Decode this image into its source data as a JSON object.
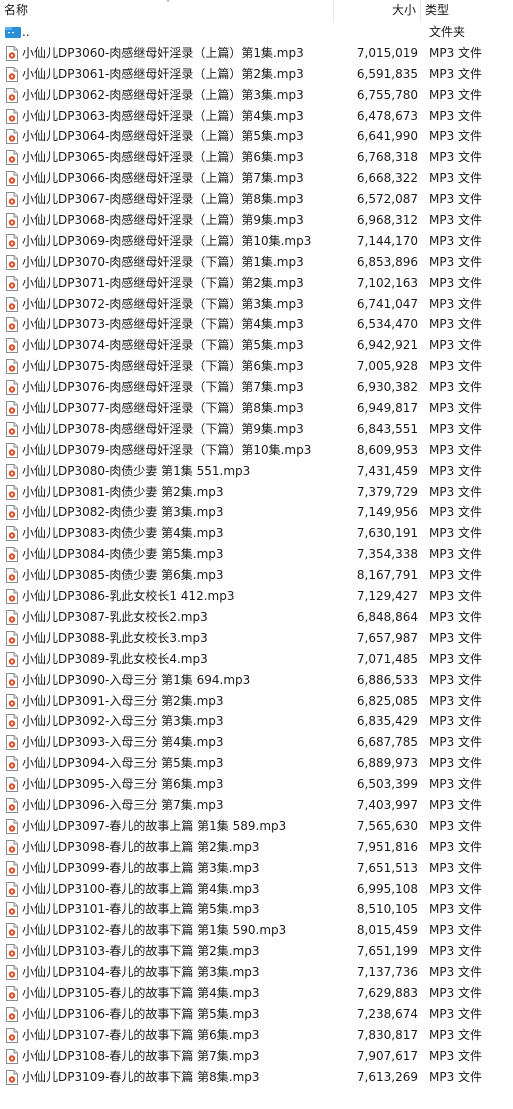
{
  "columns": {
    "name": "名称",
    "size": "大小",
    "type": "类型"
  },
  "parent": {
    "name": "..",
    "type": "文件夹"
  },
  "files": [
    {
      "name": "小仙儿DP3060-肉感继母奸淫录（上篇）第1集.mp3",
      "size": "7,015,019",
      "type": "MP3 文件"
    },
    {
      "name": "小仙儿DP3061-肉感继母奸淫录（上篇）第2集.mp3",
      "size": "6,591,835",
      "type": "MP3 文件"
    },
    {
      "name": "小仙儿DP3062-肉感继母奸淫录（上篇）第3集.mp3",
      "size": "6,755,780",
      "type": "MP3 文件"
    },
    {
      "name": "小仙儿DP3063-肉感继母奸淫录（上篇）第4集.mp3",
      "size": "6,478,673",
      "type": "MP3 文件"
    },
    {
      "name": "小仙儿DP3064-肉感继母奸淫录（上篇）第5集.mp3",
      "size": "6,641,990",
      "type": "MP3 文件"
    },
    {
      "name": "小仙儿DP3065-肉感继母奸淫录（上篇）第6集.mp3",
      "size": "6,768,318",
      "type": "MP3 文件"
    },
    {
      "name": "小仙儿DP3066-肉感继母奸淫录（上篇）第7集.mp3",
      "size": "6,668,322",
      "type": "MP3 文件"
    },
    {
      "name": "小仙儿DP3067-肉感继母奸淫录（上篇）第8集.mp3",
      "size": "6,572,087",
      "type": "MP3 文件"
    },
    {
      "name": "小仙儿DP3068-肉感继母奸淫录（上篇）第9集.mp3",
      "size": "6,968,312",
      "type": "MP3 文件"
    },
    {
      "name": "小仙儿DP3069-肉感继母奸淫录（上篇）第10集.mp3",
      "size": "7,144,170",
      "type": "MP3 文件"
    },
    {
      "name": "小仙儿DP3070-肉感继母奸淫录（下篇）第1集.mp3",
      "size": "6,853,896",
      "type": "MP3 文件"
    },
    {
      "name": "小仙儿DP3071-肉感继母奸淫录（下篇）第2集.mp3",
      "size": "7,102,163",
      "type": "MP3 文件"
    },
    {
      "name": "小仙儿DP3072-肉感继母奸淫录（下篇）第3集.mp3",
      "size": "6,741,047",
      "type": "MP3 文件"
    },
    {
      "name": "小仙儿DP3073-肉感继母奸淫录（下篇）第4集.mp3",
      "size": "6,534,470",
      "type": "MP3 文件"
    },
    {
      "name": "小仙儿DP3074-肉感继母奸淫录（下篇）第5集.mp3",
      "size": "6,942,921",
      "type": "MP3 文件"
    },
    {
      "name": "小仙儿DP3075-肉感继母奸淫录（下篇）第6集.mp3",
      "size": "7,005,928",
      "type": "MP3 文件"
    },
    {
      "name": "小仙儿DP3076-肉感继母奸淫录（下篇）第7集.mp3",
      "size": "6,930,382",
      "type": "MP3 文件"
    },
    {
      "name": "小仙儿DP3077-肉感继母奸淫录（下篇）第8集.mp3",
      "size": "6,949,817",
      "type": "MP3 文件"
    },
    {
      "name": "小仙儿DP3078-肉感继母奸淫录（下篇）第9集.mp3",
      "size": "6,843,551",
      "type": "MP3 文件"
    },
    {
      "name": "小仙儿DP3079-肉感继母奸淫录（下篇）第10集.mp3",
      "size": "8,609,953",
      "type": "MP3 文件"
    },
    {
      "name": "小仙儿DP3080-肉债少妻 第1集 551.mp3",
      "size": "7,431,459",
      "type": "MP3 文件"
    },
    {
      "name": "小仙儿DP3081-肉债少妻 第2集.mp3",
      "size": "7,379,729",
      "type": "MP3 文件"
    },
    {
      "name": "小仙儿DP3082-肉债少妻 第3集.mp3",
      "size": "7,149,956",
      "type": "MP3 文件"
    },
    {
      "name": "小仙儿DP3083-肉债少妻 第4集.mp3",
      "size": "7,630,191",
      "type": "MP3 文件"
    },
    {
      "name": "小仙儿DP3084-肉债少妻 第5集.mp3",
      "size": "7,354,338",
      "type": "MP3 文件"
    },
    {
      "name": "小仙儿DP3085-肉债少妻 第6集.mp3",
      "size": "8,167,791",
      "type": "MP3 文件"
    },
    {
      "name": "小仙儿DP3086-乳此女校长1 412.mp3",
      "size": "7,129,427",
      "type": "MP3 文件"
    },
    {
      "name": "小仙儿DP3087-乳此女校长2.mp3",
      "size": "6,848,864",
      "type": "MP3 文件"
    },
    {
      "name": "小仙儿DP3088-乳此女校长3.mp3",
      "size": "7,657,987",
      "type": "MP3 文件"
    },
    {
      "name": "小仙儿DP3089-乳此女校长4.mp3",
      "size": "7,071,485",
      "type": "MP3 文件"
    },
    {
      "name": "小仙儿DP3090-入母三分 第1集 694.mp3",
      "size": "6,886,533",
      "type": "MP3 文件"
    },
    {
      "name": "小仙儿DP3091-入母三分 第2集.mp3",
      "size": "6,825,085",
      "type": "MP3 文件"
    },
    {
      "name": "小仙儿DP3092-入母三分 第3集.mp3",
      "size": "6,835,429",
      "type": "MP3 文件"
    },
    {
      "name": "小仙儿DP3093-入母三分 第4集.mp3",
      "size": "6,687,785",
      "type": "MP3 文件"
    },
    {
      "name": "小仙儿DP3094-入母三分 第5集.mp3",
      "size": "6,889,973",
      "type": "MP3 文件"
    },
    {
      "name": "小仙儿DP3095-入母三分 第6集.mp3",
      "size": "6,503,399",
      "type": "MP3 文件"
    },
    {
      "name": "小仙儿DP3096-入母三分 第7集.mp3",
      "size": "7,403,997",
      "type": "MP3 文件"
    },
    {
      "name": "小仙儿DP3097-春儿的故事上篇 第1集 589.mp3",
      "size": "7,565,630",
      "type": "MP3 文件"
    },
    {
      "name": "小仙儿DP3098-春儿的故事上篇 第2集.mp3",
      "size": "7,951,816",
      "type": "MP3 文件"
    },
    {
      "name": "小仙儿DP3099-春儿的故事上篇 第3集.mp3",
      "size": "7,651,513",
      "type": "MP3 文件"
    },
    {
      "name": "小仙儿DP3100-春儿的故事上篇 第4集.mp3",
      "size": "6,995,108",
      "type": "MP3 文件"
    },
    {
      "name": "小仙儿DP3101-春儿的故事上篇 第5集.mp3",
      "size": "8,510,105",
      "type": "MP3 文件"
    },
    {
      "name": "小仙儿DP3102-春儿的故事下篇 第1集 590.mp3",
      "size": "8,015,459",
      "type": "MP3 文件"
    },
    {
      "name": "小仙儿DP3103-春儿的故事下篇 第2集.mp3",
      "size": "7,651,199",
      "type": "MP3 文件"
    },
    {
      "name": "小仙儿DP3104-春儿的故事下篇 第3集.mp3",
      "size": "7,137,736",
      "type": "MP3 文件"
    },
    {
      "name": "小仙儿DP3105-春儿的故事下篇 第4集.mp3",
      "size": "7,629,883",
      "type": "MP3 文件"
    },
    {
      "name": "小仙儿DP3106-春儿的故事下篇 第5集.mp3",
      "size": "7,238,674",
      "type": "MP3 文件"
    },
    {
      "name": "小仙儿DP3107-春儿的故事下篇 第6集.mp3",
      "size": "7,830,817",
      "type": "MP3 文件"
    },
    {
      "name": "小仙儿DP3108-春儿的故事下篇 第7集.mp3",
      "size": "7,907,617",
      "type": "MP3 文件"
    },
    {
      "name": "小仙儿DP3109-春儿的故事下篇 第8集.mp3",
      "size": "7,613,269",
      "type": "MP3 文件"
    }
  ]
}
